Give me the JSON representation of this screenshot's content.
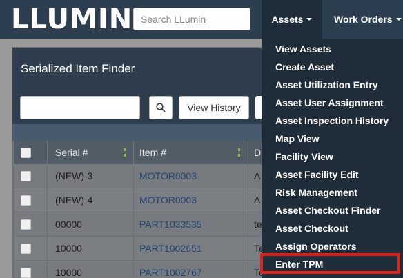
{
  "header": {
    "logo_text": "LLUMIN",
    "search": {
      "placeholder": "Search LLumin",
      "value": ""
    },
    "nav": [
      {
        "label": "Assets",
        "active": true
      },
      {
        "label": "Work Orders",
        "active": false
      }
    ]
  },
  "panel": {
    "title": "Serialized Item Finder",
    "search_input_value": "",
    "search_button_icon": "search-icon",
    "view_history_label": "View History"
  },
  "table": {
    "columns": [
      "Serial #",
      "Item #",
      "D"
    ],
    "rows": [
      {
        "serial": "(NEW)-3",
        "item": "MOTOR0003",
        "desc": "A"
      },
      {
        "serial": "(NEW)-4",
        "item": "MOTOR0003",
        "desc": "A"
      },
      {
        "serial": "00000",
        "item": "PART1033535",
        "desc": "te"
      },
      {
        "serial": "10000",
        "item": "PART1002651",
        "desc": "Te"
      },
      {
        "serial": "10000",
        "item": "PART1002767",
        "desc": "Te"
      }
    ]
  },
  "assets_menu": {
    "items": [
      "View Assets",
      "Create Asset",
      "Asset Utilization Entry",
      "Asset User Assignment",
      "Asset Inspection History",
      "Map View",
      "Facility View",
      "Asset Facility Edit",
      "Risk Management",
      "Asset Checkout Finder",
      "Asset Checkout",
      "Assign Operators",
      "Enter TPM"
    ],
    "highlighted": "Enter TPM"
  },
  "colors": {
    "nav_bg": "#2c3e50",
    "dropdown_bg": "#1f2d3a",
    "highlight_border": "#e0201b",
    "logo_accent": "#7ec845",
    "link": "#22456e"
  }
}
